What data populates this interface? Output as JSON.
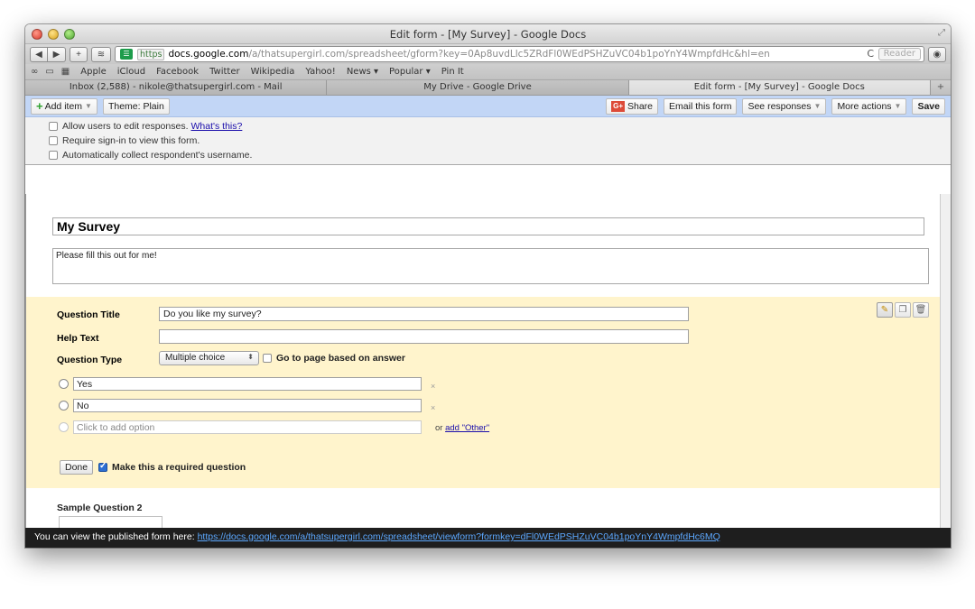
{
  "window": {
    "title": "Edit form - [My Survey] - Google Docs"
  },
  "toolbar": {
    "back_icon": "back-arrow-icon",
    "forward_icon": "forward-arrow-icon",
    "add_label": "+",
    "url_https": "https",
    "url_domain": "docs.google.com",
    "url_path": "/a/thatsupergirl.com/spreadsheet/gform?key=0Ap8uvdLlc5ZRdFl0WEdPSHZuVC04b1poYnY4WmpfdHc&hl=en",
    "reload_label": "C",
    "reader_label": "Reader"
  },
  "bookmarks": [
    "Apple",
    "iCloud",
    "Facebook",
    "Twitter",
    "Wikipedia",
    "Yahoo!",
    "News ▾",
    "Popular ▾",
    "Pin It"
  ],
  "tabs": [
    {
      "label": "Inbox (2,588) - nikole@thatsupergirl.com - Mail",
      "active": false
    },
    {
      "label": "My Drive - Google Drive",
      "active": false
    },
    {
      "label": "Edit form - [My Survey] - Google Docs",
      "active": true
    }
  ],
  "formbar": {
    "add_item": "Add item",
    "theme": "Theme: Plain",
    "share": "Share",
    "email": "Email this form",
    "see_responses": "See responses",
    "more_actions": "More actions",
    "save": "Save"
  },
  "settings": {
    "allow_edit": "Allow users to edit responses.",
    "whats_this": "What's this?",
    "require_signin": "Require sign-in to view this form.",
    "collect_username": "Automatically collect respondent's username."
  },
  "form": {
    "title": "My Survey",
    "description": "Please fill this out for me!"
  },
  "question": {
    "title_label": "Question Title",
    "title_value": "Do you like my survey?",
    "help_label": "Help Text",
    "help_value": "",
    "type_label": "Question Type",
    "type_value": "Multiple choice",
    "goto_label": "Go to page based on answer",
    "options": [
      "Yes",
      "No"
    ],
    "add_option_placeholder": "Click to add option",
    "or_text": "or",
    "add_other": "add \"Other\"",
    "done": "Done",
    "required_label": "Make this a required question",
    "required_checked": true
  },
  "sample_question": {
    "label": "Sample Question 2"
  },
  "statusbar": {
    "text": "You can view the published form here:",
    "link": "https://docs.google.com/a/thatsupergirl.com/spreadsheet/viewform?formkey=dFl0WEdPSHZuVC04b1poYnY4WmpfdHc6MQ"
  }
}
